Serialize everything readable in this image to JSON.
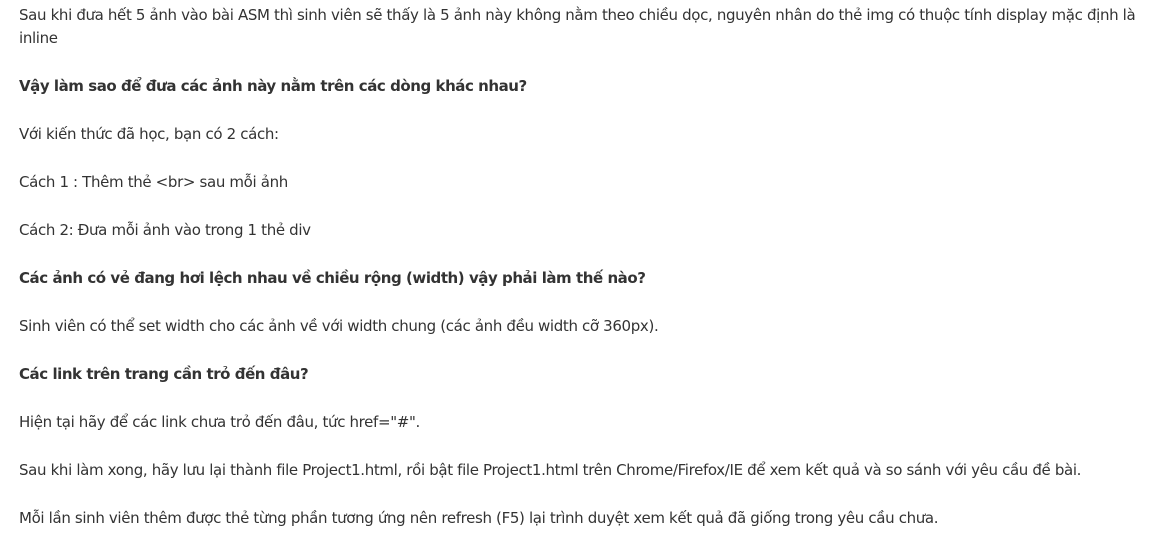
{
  "article": {
    "paragraphs": [
      {
        "text": "Sau khi đưa hết 5 ảnh vào bài ASM thì sinh viên sẽ thấy là 5 ảnh này không nằm theo chiều dọc, nguyên nhân do thẻ img có thuộc tính display mặc định là inline",
        "bold": false
      },
      {
        "text": "Vậy làm sao để đưa các ảnh này nằm trên các dòng khác nhau?",
        "bold": true
      },
      {
        "text": "Với kiến thức đã học, bạn có 2 cách:",
        "bold": false
      },
      {
        "text": "Cách 1 : Thêm thẻ <br> sau mỗi ảnh",
        "bold": false
      },
      {
        "text": "Cách 2: Đưa mỗi ảnh vào trong 1 thẻ div",
        "bold": false
      },
      {
        "text": "Các ảnh có vẻ đang hơi lệch nhau về chiều rộng (width) vậy phải làm thế nào?",
        "bold": true
      },
      {
        "text": "Sinh viên có thể set width cho các ảnh về với width chung (các ảnh đều width cỡ 360px).",
        "bold": false
      },
      {
        "text": "Các link trên trang cần trỏ đến đâu?",
        "bold": true
      },
      {
        "text": "Hiện tại hãy để các link chưa trỏ đến đâu, tức href=\"#\".",
        "bold": false
      },
      {
        "text": "Sau khi làm xong, hãy lưu lại thành file Project1.html, rồi bật file Project1.html trên Chrome/Firefox/IE để xem kết quả và so sánh với yêu cầu đề bài.",
        "bold": false
      },
      {
        "text": "Mỗi lần sinh viên thêm được thẻ từng phần tương ứng nên refresh (F5) lại trình duyệt xem kết quả đã giống trong yêu cầu chưa.",
        "bold": false
      }
    ]
  }
}
